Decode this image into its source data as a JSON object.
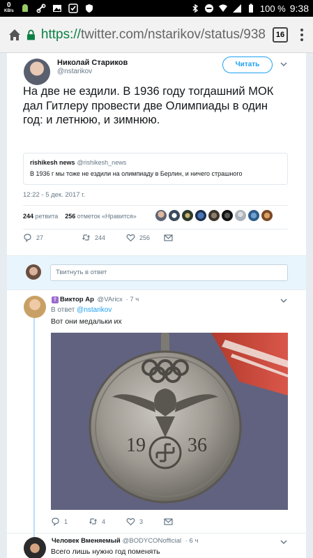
{
  "status_bar": {
    "speed_value": "0",
    "speed_unit": "KB/s",
    "battery": "100 %",
    "time": "9:38"
  },
  "browser": {
    "url_scheme": "https://",
    "url_rest": "twitter.com/nstarikov/status/938",
    "tab_count": "16"
  },
  "tweet": {
    "author_name": "Николай Стариков",
    "author_handle": "@nstarikov",
    "follow_label": "Читать",
    "text": "На две не ездили. В 1936 году тогдашний МОК дал Гитлеру провести две Олимпиады в один год: и летнюю, и зимнюю.",
    "quote": {
      "name": "rishikesh news",
      "handle": "@rishikesh_news",
      "text": "В 1936 г мы тоже не ездили на олимпиаду в Берлин, и ничего страшного"
    },
    "timestamp": "12:22 - 5 дек. 2017 г.",
    "retweets_count": "244",
    "retweets_label": "ретвита",
    "likes_count": "256",
    "likes_label": "отметок «Нравится»",
    "actions": {
      "replies": "27",
      "retweets": "244",
      "likes": "256"
    }
  },
  "composer": {
    "placeholder": "Твитнуть в ответ"
  },
  "reply": {
    "glyph": "☦",
    "name": "Виктор Ар",
    "handle": "@VAricx",
    "time": "· 7 ч",
    "reply_to_prefix": "В ответ",
    "reply_to_handle": "@nstarikov",
    "text": "Вот они медальки их",
    "medal_year_left": "19",
    "medal_year_right": "36",
    "actions": {
      "replies": "1",
      "retweets": "4",
      "likes": "3"
    }
  },
  "next_tweet": {
    "name": "Человек Вменяемый",
    "handle": "@BODYCONofficial",
    "time": "· 6 ч",
    "text": "Всего лишь нужно год поменять"
  },
  "colors": {
    "accent": "#1da1f2",
    "url_green": "#0b8043",
    "thread_line": "#b5dff8",
    "composer_bg": "#e8f5fd"
  }
}
